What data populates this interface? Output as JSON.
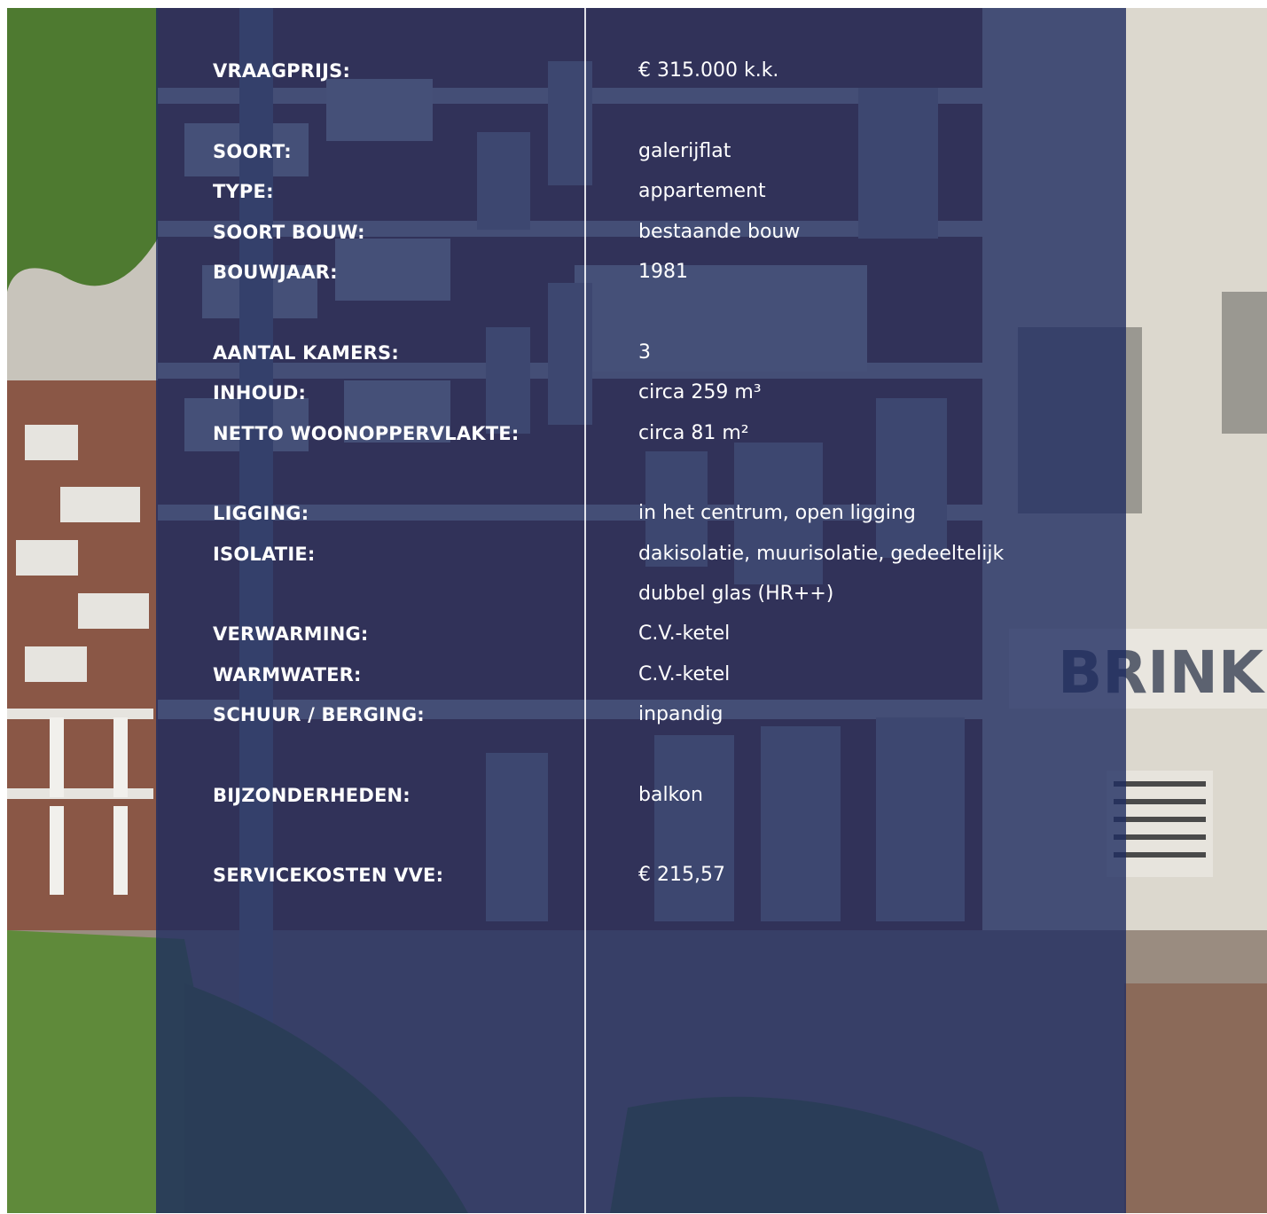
{
  "specs": [
    {
      "label": "VRAAGPRIJS:",
      "value": "€ 315.000 k.k."
    },
    {
      "label": "SOORT:",
      "value": "galerijflat"
    },
    {
      "label": "TYPE:",
      "value": "appartement"
    },
    {
      "label": "SOORT BOUW:",
      "value": "bestaande bouw"
    },
    {
      "label": "BOUWJAAR:",
      "value": "1981"
    },
    {
      "label": "AANTAL KAMERS:",
      "value": "3"
    },
    {
      "label": "INHOUD:",
      "value": "circa 259 m³"
    },
    {
      "label": "NETTO WOONOPPERVLAKTE:",
      "value": "circa 81 m²"
    },
    {
      "label": "LIGGING:",
      "value": "in het centrum, open ligging"
    },
    {
      "label": "ISOLATIE:",
      "value": "dakisolatie, muurisolatie, gedeeltelijk",
      "value_line2": "dubbel glas (HR++)"
    },
    {
      "label": "VERWARMING:",
      "value": "C.V.-ketel"
    },
    {
      "label": "WARMWATER:",
      "value": "C.V.-ketel"
    },
    {
      "label": "SCHUUR / BERGING:",
      "value": "inpandig"
    },
    {
      "label": "BIJZONDERHEDEN:",
      "value": "balkon"
    },
    {
      "label": "SERVICEKOSTEN VVE:",
      "value": "€ 215,57"
    }
  ],
  "photo_sign_text": "BRINKS",
  "colors": {
    "overlay": "#1e2c60",
    "text": "#ffffff",
    "brick": "#7d4d3e",
    "foliage": "#5f8a3a"
  }
}
